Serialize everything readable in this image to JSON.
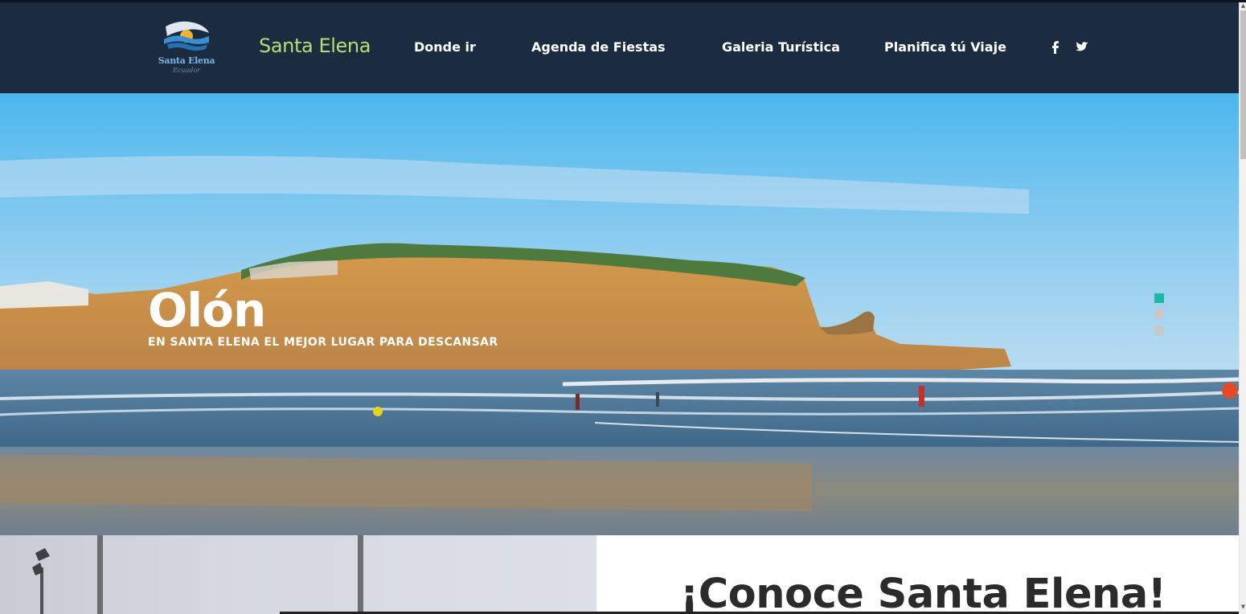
{
  "header": {
    "logo_text": "Santa Elena",
    "logo_subtext": "Ecuador",
    "brand": "Santa Elena",
    "nav": [
      {
        "label": "Donde ir"
      },
      {
        "label": "Agenda de Fiestas"
      },
      {
        "label": "Galeria Turística"
      },
      {
        "label": "Planifica tú Viaje"
      }
    ],
    "social": [
      {
        "icon": "facebook-icon"
      },
      {
        "icon": "twitter-icon"
      }
    ]
  },
  "hero": {
    "title": "Olón",
    "subtitle": "EN SANTA ELENA EL MEJOR LUGAR PARA DESCANSAR",
    "slides": [
      {
        "active": true
      },
      {
        "active": false
      },
      {
        "active": false
      }
    ]
  },
  "section": {
    "title": "¡Conoce Santa Elena!"
  },
  "colors": {
    "navbar": "#1b2c40",
    "brand": "#b9dd74",
    "active_dot": "#1fb7a3",
    "inactive_dot": "#c8c8c8"
  }
}
